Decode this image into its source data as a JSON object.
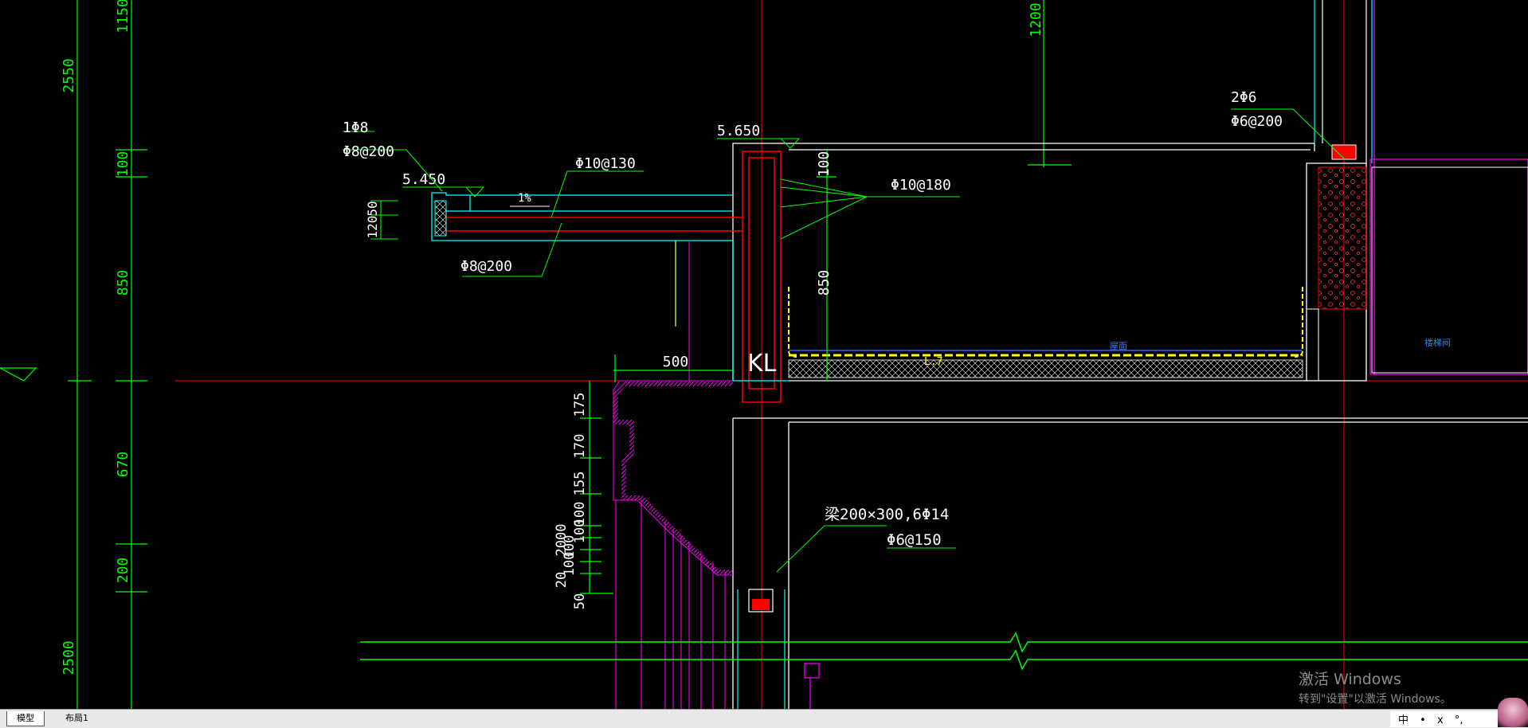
{
  "drawing": {
    "dims_vertical_left": [
      "2550",
      "1150",
      "100",
      "850",
      "670",
      "200",
      "2500"
    ],
    "dims_top_right": "1200",
    "elevations": [
      "5.650",
      "5.450"
    ],
    "dims_parapet": [
      "100",
      "850"
    ],
    "dims_cantilever": [
      "50",
      "120"
    ],
    "slope": "1%",
    "rebar_labels": [
      "1Φ8",
      "Φ8@200",
      "Φ10@130",
      "Φ8@200",
      "Φ10@180",
      "2Φ6",
      "Φ6@200"
    ],
    "beam_label": "KL",
    "dim_500": "500",
    "cornice_dims": [
      "175",
      "170",
      "155",
      "100",
      "100",
      "100",
      "100",
      "2000",
      "20",
      "50"
    ],
    "beam_note": [
      "梁200×300,6Φ14",
      "Φ6@150"
    ],
    "roof_label": "屋面",
    "stair_label": "楼梯间",
    "roof_layer_label": "L.7"
  },
  "tabs": [
    "模型",
    "布局1"
  ],
  "activation": {
    "title": "激活 Windows",
    "subtitle": "转到\"设置\"以激活 Windows。"
  },
  "ime": [
    "中",
    "•",
    "ⅹ",
    "°,"
  ],
  "colors": {
    "green": "#00ff00",
    "red": "#ff0000",
    "cyan": "#00ffff",
    "white": "#ffffff",
    "magenta": "#ff00ff",
    "yellow": "#ffff00",
    "blue": "#3060ff"
  }
}
